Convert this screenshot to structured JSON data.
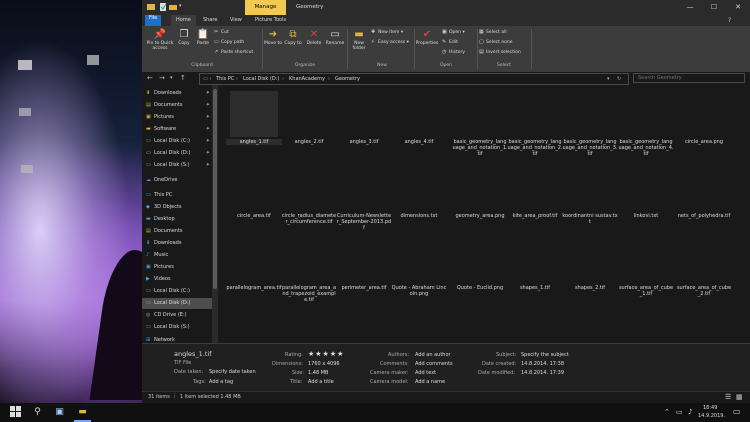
{
  "window": {
    "manage_label": "Manage",
    "title": "Geometry",
    "minimize": "—",
    "maximize": "☐",
    "close": "✕"
  },
  "tabs": [
    "File",
    "Home",
    "Share",
    "View",
    "Picture Tools"
  ],
  "ribbon": {
    "pin_quick": "Pin to Quick access",
    "copy": "Copy",
    "paste": "Paste",
    "cut": "Cut",
    "copy_path": "Copy path",
    "paste_shortcut": "Paste shortcut",
    "clipboard_label": "Clipboard",
    "move_to": "Move to",
    "copy_to": "Copy to",
    "delete": "Delete",
    "rename": "Rename",
    "organize_label": "Organize",
    "new_folder": "New folder",
    "new_item": "New item",
    "easy_access": "Easy access",
    "new_label": "New",
    "properties": "Properties",
    "open": "Open",
    "edit": "Edit",
    "history": "History",
    "open_label": "Open",
    "select_all": "Select all",
    "select_none": "Select none",
    "invert_selection": "Invert selection",
    "select_label": "Select"
  },
  "address": {
    "crumbs": [
      "This PC",
      "Local Disk (D:)",
      "KhanAcademy",
      "Geometry"
    ],
    "search_placeholder": "Search Geometry"
  },
  "nav": [
    {
      "label": "Downloads",
      "pinned": true
    },
    {
      "label": "Documents",
      "pinned": true
    },
    {
      "label": "Pictures",
      "pinned": true
    },
    {
      "label": "Software",
      "pinned": true
    },
    {
      "label": "Local Disk (C:)",
      "pinned": true
    },
    {
      "label": "Local Disk (D:)",
      "pinned": true
    },
    {
      "label": "Local Disk (S:)",
      "pinned": true
    },
    {
      "label": "OneDrive"
    },
    {
      "label": "This PC"
    },
    {
      "label": "3D Objects"
    },
    {
      "label": "Desktop"
    },
    {
      "label": "Documents"
    },
    {
      "label": "Downloads"
    },
    {
      "label": "Music"
    },
    {
      "label": "Pictures"
    },
    {
      "label": "Videos"
    },
    {
      "label": "Local Disk (C:)"
    },
    {
      "label": "Local Disk (D:)",
      "selected": true
    },
    {
      "label": "CD Drive (E:)"
    },
    {
      "label": "Local Disk (S:)"
    },
    {
      "label": "Network"
    }
  ],
  "files": [
    "angles_1.tif",
    "angles_2.tif",
    "angles_3.tif",
    "angles_4.tif",
    "basic_geometry_language_and_notation_1.tif",
    "basic_geometry_language_and_notation_2.tif",
    "basic_geometry_language_and_notation_3.tif",
    "basic_geometry_language_and_notation_4.tif",
    "circle_area.png",
    "circle_area.tif",
    "circle_radius_diameter_circumference.tif",
    "Curriculum-Newsletter_September-2013.pdf",
    "dimensions.txt",
    "geometry_area.png",
    "kite_area_proof.tif",
    "koordinantni sustav.txt",
    "linkovi.txt",
    "nets_of_polyhedra.tif",
    "parallelogram_area.tif",
    "parallelogram_area_and_trapezoid_example.tif",
    "perimeter_area.tif",
    "Quote - Abraham Lincoln.png",
    "Quote - Euclid.png",
    "shapes_1.tif",
    "shapes_2.tif",
    "surface_area_of_cube_1.tif",
    "surface_area_of_cube_2.tif"
  ],
  "details": {
    "name": "angles_1.tif",
    "type": "TIF File",
    "date_taken_label": "Date taken:",
    "date_taken": "Specify date taken",
    "tags_label": "Tags:",
    "tags": "Add a tag",
    "rating_label": "Rating:",
    "rating_stars": 5,
    "rating": "★★★★★",
    "dimensions_label": "Dimensions:",
    "dimensions": "1760 x 4096",
    "size_label": "Size:",
    "size": "1.48 MB",
    "title_label": "Title:",
    "title": "Add a title",
    "authors_label": "Authors:",
    "authors": "Add an author",
    "comments_label": "Comments:",
    "comments": "Add comments",
    "camera_maker_label": "Camera maker:",
    "camera_maker": "Add text",
    "camera_model_label": "Camera model:",
    "camera_model": "Add a name",
    "subject_label": "Subject:",
    "subject": "Specify the subject",
    "date_created_label": "Date created:",
    "date_created": "14.8.2014. 17:38",
    "date_modified_label": "Date modified:",
    "date_modified": "14.8.2014. 17:39"
  },
  "status": {
    "items": "31 items",
    "selected": "1 item selected  1.48 MB"
  },
  "taskbar": {
    "time": "18:49",
    "date": "14.9.2019."
  }
}
